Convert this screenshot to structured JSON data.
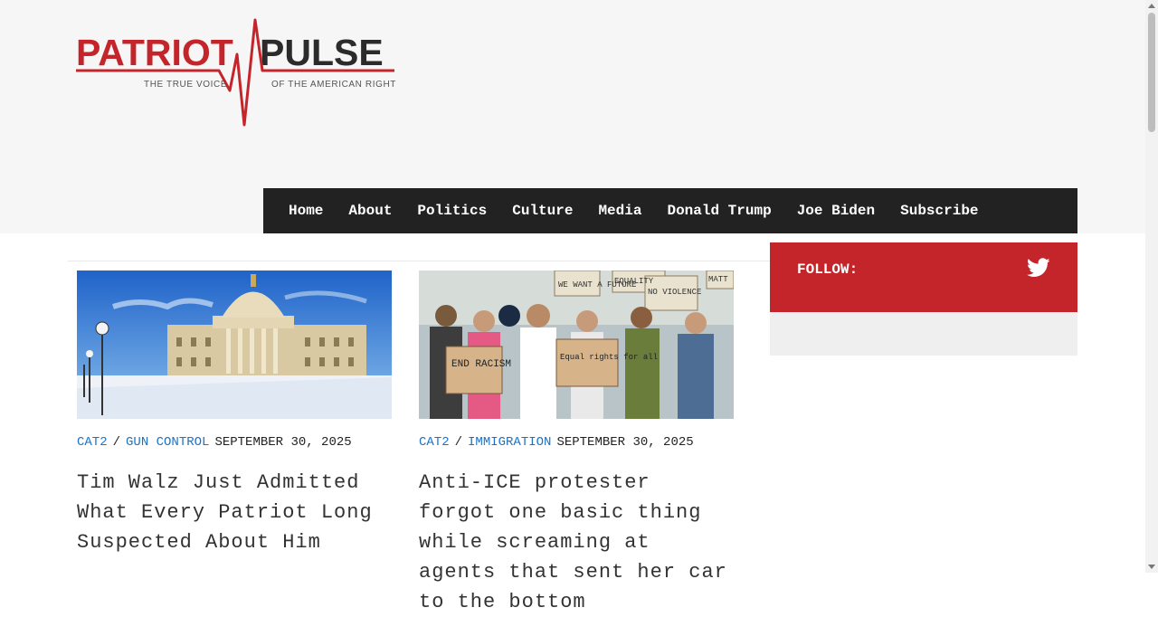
{
  "brand": {
    "name_left": "PATRIOT",
    "name_right": "PULSE",
    "tagline_left": "THE TRUE VOICE",
    "tagline_right": "OF THE AMERICAN RIGHT",
    "colors": {
      "red": "#c4252b",
      "dark": "#222222"
    }
  },
  "nav": {
    "items": [
      "Home",
      "About",
      "Politics",
      "Culture",
      "Media",
      "Donald Trump",
      "Joe Biden",
      "Subscribe"
    ]
  },
  "posts": [
    {
      "image": "state-capitol-winter-photo",
      "category": "CAT2",
      "separator": "/",
      "tag": "GUN CONTROL",
      "date": "SEPTEMBER 30, 2025",
      "title": "Tim Walz Just Admitted What Every Patriot Long Suspected About Him"
    },
    {
      "image": "protest-crowd-photo",
      "category": "CAT2",
      "separator": "/",
      "tag": "IMMIGRATION",
      "date": "SEPTEMBER 30, 2025",
      "title": "Anti-ICE protester forgot one basic thing while screaming at agents that sent her car to the bottom"
    }
  ],
  "sidebar": {
    "follow_label": "FOLLOW:",
    "icon": "twitter-icon"
  },
  "protest_signs": {
    "sign1": "WE WANT A FUTURE",
    "sign2": "EQUALITY",
    "sign3": "NO VIOLENCE",
    "sign4": "END RACISM",
    "sign5": "Equal rights for all",
    "sign6": "MATT"
  }
}
